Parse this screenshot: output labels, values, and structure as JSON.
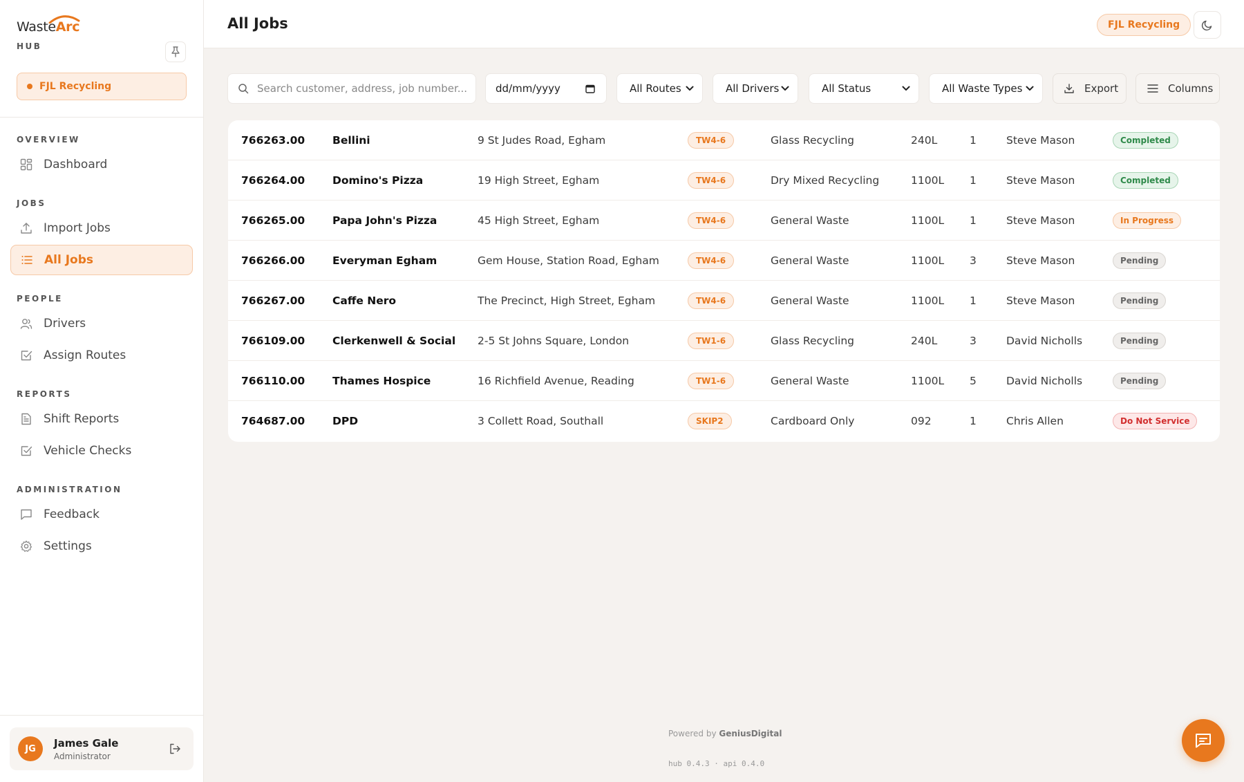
{
  "brand": {
    "name_part1": "Waste",
    "name_part2": "Arc",
    "subtitle": "HUB"
  },
  "org": {
    "name": "FJL Recycling"
  },
  "sidebar": {
    "sections": [
      {
        "title": "OVERVIEW",
        "items": [
          {
            "label": "Dashboard",
            "icon": "dashboard-icon"
          }
        ]
      },
      {
        "title": "JOBS",
        "items": [
          {
            "label": "Import Jobs",
            "icon": "upload-icon"
          },
          {
            "label": "All Jobs",
            "icon": "list-icon",
            "active": true
          }
        ]
      },
      {
        "title": "PEOPLE",
        "items": [
          {
            "label": "Drivers",
            "icon": "users-icon"
          },
          {
            "label": "Assign Routes",
            "icon": "check-square-icon"
          }
        ]
      },
      {
        "title": "REPORTS",
        "items": [
          {
            "label": "Shift Reports",
            "icon": "file-text-icon"
          },
          {
            "label": "Vehicle Checks",
            "icon": "check-square-icon"
          }
        ]
      },
      {
        "title": "ADMINISTRATION",
        "items": [
          {
            "label": "Feedback",
            "icon": "message-icon"
          },
          {
            "label": "Settings",
            "icon": "gear-icon"
          }
        ]
      }
    ]
  },
  "user": {
    "initials": "JG",
    "name": "James Gale",
    "role": "Administrator"
  },
  "header": {
    "title": "All Jobs",
    "org_badge": "FJL Recycling"
  },
  "filters": {
    "search_placeholder": "Search customer, address, job number...",
    "date_placeholder": "dd/mm/yyyy",
    "routes": "All Routes",
    "drivers": "All Drivers",
    "status": "All Status",
    "waste_types": "All Waste Types",
    "export_label": "Export",
    "columns_label": "Columns"
  },
  "jobs": [
    {
      "job": "766263.00",
      "customer": "Bellini",
      "address": "9 St Judes Road, Egham",
      "route": "TW4-6",
      "waste": "Glass Recycling",
      "size": "240L",
      "qty": "1",
      "driver": "Steve Mason",
      "status": "Completed",
      "status_class": "st-completed"
    },
    {
      "job": "766264.00",
      "customer": "Domino's Pizza",
      "address": "19 High Street, Egham",
      "route": "TW4-6",
      "waste": "Dry Mixed Recycling",
      "size": "1100L",
      "qty": "1",
      "driver": "Steve Mason",
      "status": "Completed",
      "status_class": "st-completed"
    },
    {
      "job": "766265.00",
      "customer": "Papa John's Pizza",
      "address": "45 High Street, Egham",
      "route": "TW4-6",
      "waste": "General Waste",
      "size": "1100L",
      "qty": "1",
      "driver": "Steve Mason",
      "status": "In Progress",
      "status_class": "st-inprogress"
    },
    {
      "job": "766266.00",
      "customer": "Everyman Egham",
      "address": "Gem House, Station Road, Egham",
      "route": "TW4-6",
      "waste": "General Waste",
      "size": "1100L",
      "qty": "3",
      "driver": "Steve Mason",
      "status": "Pending",
      "status_class": "st-pending"
    },
    {
      "job": "766267.00",
      "customer": "Caffe Nero",
      "address": "The Precinct, High Street, Egham",
      "route": "TW4-6",
      "waste": "General Waste",
      "size": "1100L",
      "qty": "1",
      "driver": "Steve Mason",
      "status": "Pending",
      "status_class": "st-pending"
    },
    {
      "job": "766109.00",
      "customer": "Clerkenwell & Social",
      "address": "2-5 St Johns Square, London",
      "route": "TW1-6",
      "waste": "Glass Recycling",
      "size": "240L",
      "qty": "3",
      "driver": "David Nicholls",
      "status": "Pending",
      "status_class": "st-pending"
    },
    {
      "job": "766110.00",
      "customer": "Thames Hospice",
      "address": "16 Richfield Avenue, Reading",
      "route": "TW1-6",
      "waste": "General Waste",
      "size": "1100L",
      "qty": "5",
      "driver": "David Nicholls",
      "status": "Pending",
      "status_class": "st-pending"
    },
    {
      "job": "764687.00",
      "customer": "DPD",
      "address": "3 Collett Road, Southall",
      "route": "SKIP2",
      "waste": "Cardboard Only",
      "size": "092",
      "qty": "1",
      "driver": "Chris Allen",
      "status": "Do Not Service",
      "status_class": "st-dns"
    }
  ],
  "footer": {
    "powered_prefix": "Powered by",
    "powered_brand": "GeniusDigital",
    "version": "hub 0.4.3 · api 0.4.0"
  },
  "colors": {
    "accent": "#e8781e",
    "accent_soft": "#fdeee3",
    "completed": "#2f8a4a",
    "do_not_service": "#d22f2f"
  }
}
